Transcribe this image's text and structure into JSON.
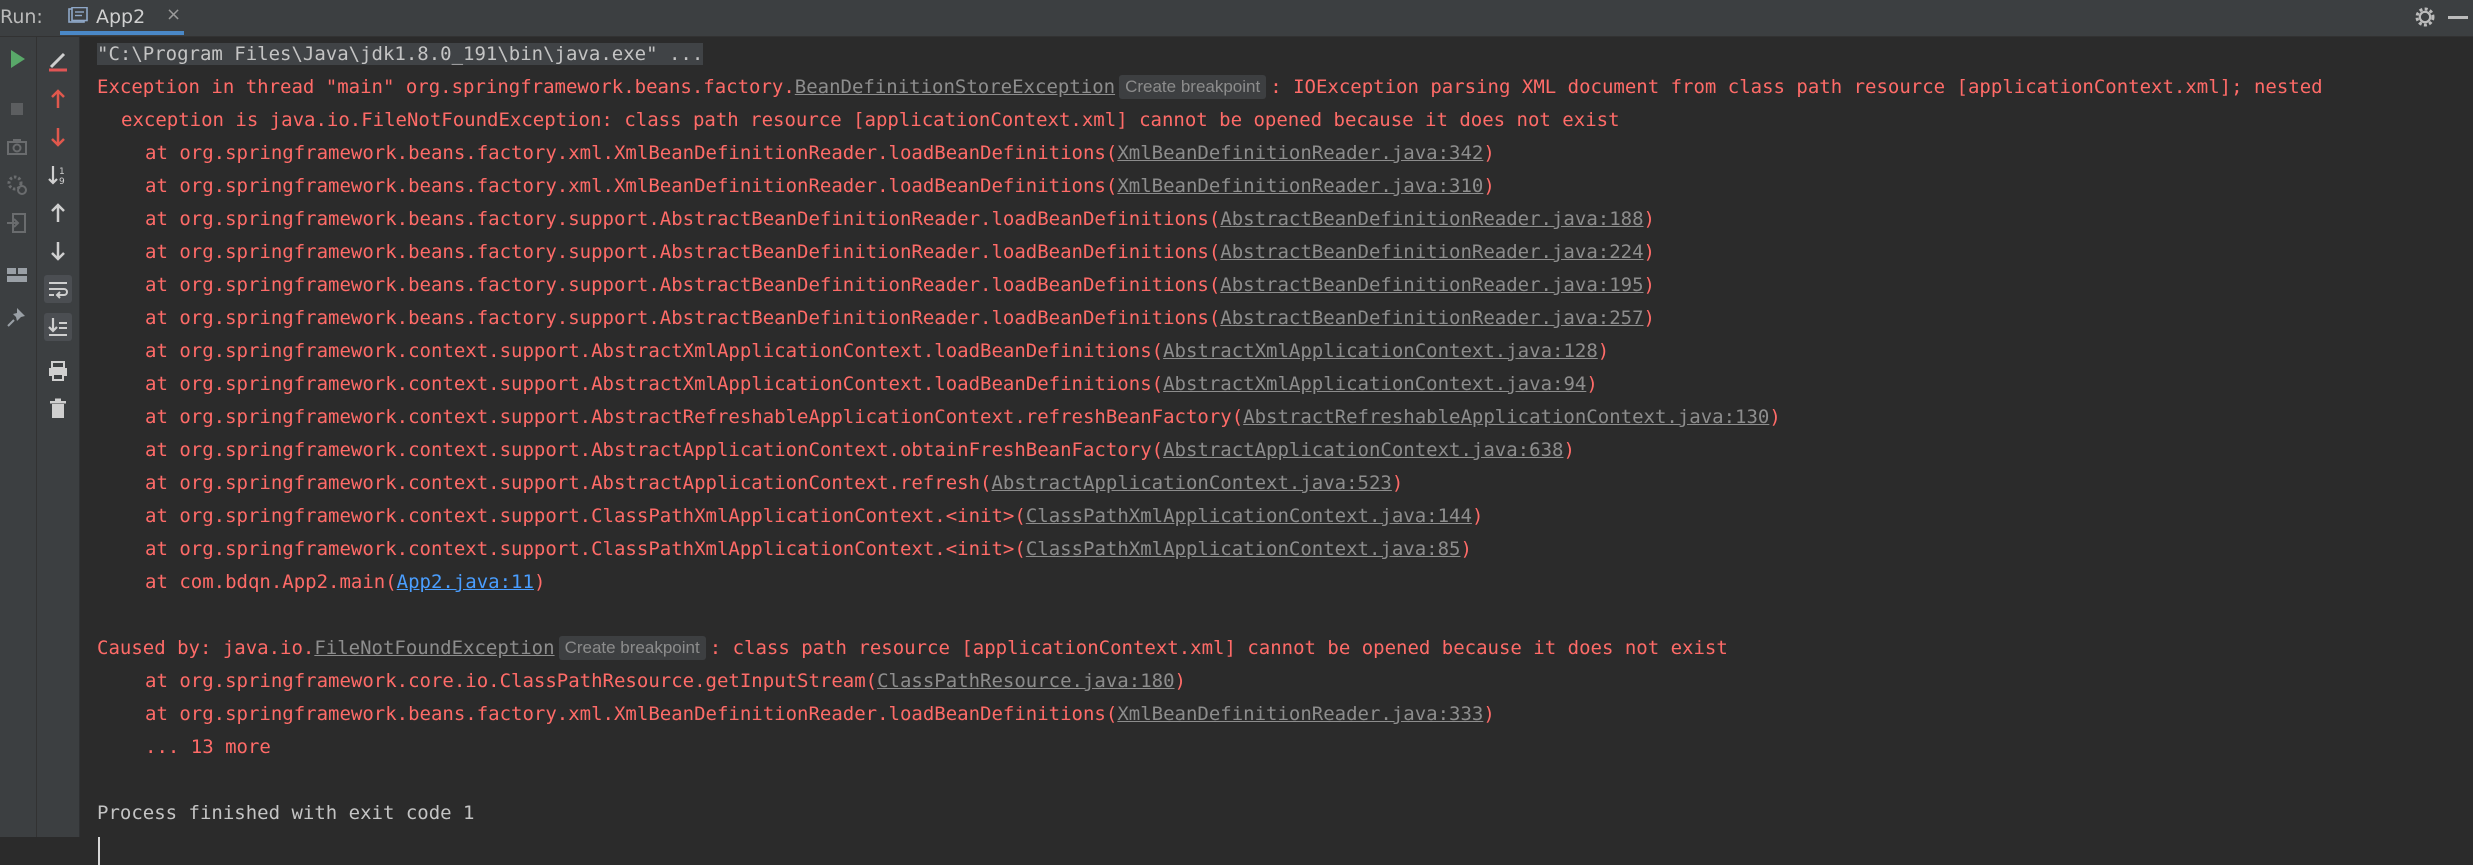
{
  "header": {
    "run_label": "Run:",
    "tab_title": "App2",
    "tab_close": "×"
  },
  "icons": {
    "left_toolbar": [
      "run-icon",
      "stop-icon",
      "camera-icon",
      "settings-icon",
      "exit-icon",
      "layout-icon",
      "pin-icon"
    ],
    "console_toolbar": [
      "rerun-failed-icon",
      "arrow-up-icon",
      "arrow-down-icon",
      "sort-icon",
      "up-icon",
      "down-icon",
      "soft-wrap-icon",
      "scroll-to-end-icon",
      "print-icon",
      "trash-icon"
    ]
  },
  "colors": {
    "error": "#ff6b68",
    "plain": "#c4c4c4",
    "link": "#8d8d8d",
    "user_link": "#4a9eff",
    "tab_underline": "#4a88c7"
  },
  "console": {
    "command": "\"C:\\Program Files\\Java\\jdk1.8.0_191\\bin\\java.exe\" ...",
    "exception_prefix": "Exception in thread \"main\" org.springframework.beans.factory.",
    "exception_class": "BeanDefinitionStoreException",
    "create_breakpoint": "Create breakpoint",
    "exception_message": ": IOException parsing XML document from class path resource [applicationContext.xml]; nested",
    "exception_message_cont": "exception is java.io.FileNotFoundException: class path resource [applicationContext.xml] cannot be opened because it does not exist",
    "stack1": [
      {
        "at": "at org.springframework.beans.factory.xml.XmlBeanDefinitionReader.loadBeanDefinitions(",
        "file": "XmlBeanDefinitionReader.java:342",
        "end": ")"
      },
      {
        "at": "at org.springframework.beans.factory.xml.XmlBeanDefinitionReader.loadBeanDefinitions(",
        "file": "XmlBeanDefinitionReader.java:310",
        "end": ")"
      },
      {
        "at": "at org.springframework.beans.factory.support.AbstractBeanDefinitionReader.loadBeanDefinitions(",
        "file": "AbstractBeanDefinitionReader.java:188",
        "end": ")"
      },
      {
        "at": "at org.springframework.beans.factory.support.AbstractBeanDefinitionReader.loadBeanDefinitions(",
        "file": "AbstractBeanDefinitionReader.java:224",
        "end": ")"
      },
      {
        "at": "at org.springframework.beans.factory.support.AbstractBeanDefinitionReader.loadBeanDefinitions(",
        "file": "AbstractBeanDefinitionReader.java:195",
        "end": ")"
      },
      {
        "at": "at org.springframework.beans.factory.support.AbstractBeanDefinitionReader.loadBeanDefinitions(",
        "file": "AbstractBeanDefinitionReader.java:257",
        "end": ")"
      },
      {
        "at": "at org.springframework.context.support.AbstractXmlApplicationContext.loadBeanDefinitions(",
        "file": "AbstractXmlApplicationContext.java:128",
        "end": ")"
      },
      {
        "at": "at org.springframework.context.support.AbstractXmlApplicationContext.loadBeanDefinitions(",
        "file": "AbstractXmlApplicationContext.java:94",
        "end": ")"
      },
      {
        "at": "at org.springframework.context.support.AbstractRefreshableApplicationContext.refreshBeanFactory(",
        "file": "AbstractRefreshableApplicationContext.java:130",
        "end": ")"
      },
      {
        "at": "at org.springframework.context.support.AbstractApplicationContext.obtainFreshBeanFactory(",
        "file": "AbstractApplicationContext.java:638",
        "end": ")"
      },
      {
        "at": "at org.springframework.context.support.AbstractApplicationContext.refresh(",
        "file": "AbstractApplicationContext.java:523",
        "end": ")"
      },
      {
        "at": "at org.springframework.context.support.ClassPathXmlApplicationContext.<init>(",
        "file": "ClassPathXmlApplicationContext.java:144",
        "end": ")"
      },
      {
        "at": "at org.springframework.context.support.ClassPathXmlApplicationContext.<init>(",
        "file": "ClassPathXmlApplicationContext.java:85",
        "end": ")"
      },
      {
        "at": "at com.bdqn.App2.main(",
        "file": "App2.java:11",
        "end": ")"
      }
    ],
    "caused_prefix": "Caused by: java.io.",
    "caused_class": "FileNotFoundException",
    "caused_message": ": class path resource [applicationContext.xml] cannot be opened because it does not exist",
    "stack2": [
      {
        "at": "at org.springframework.core.io.ClassPathResource.getInputStream(",
        "file": "ClassPathResource.java:180",
        "end": ")"
      },
      {
        "at": "at org.springframework.beans.factory.xml.XmlBeanDefinitionReader.loadBeanDefinitions(",
        "file": "XmlBeanDefinitionReader.java:333",
        "end": ")"
      }
    ],
    "more": "... 13 more",
    "exit_message": "Process finished with exit code 1"
  }
}
